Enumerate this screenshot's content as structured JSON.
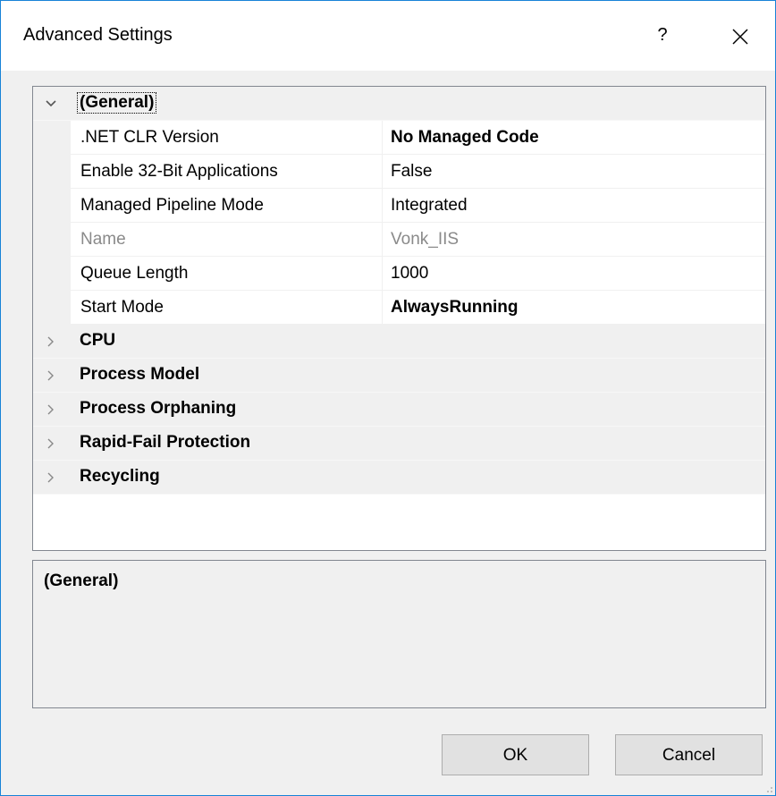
{
  "window": {
    "title": "Advanced Settings",
    "help_label": "?",
    "accent_color": "#1883d7"
  },
  "grid": {
    "general_category": {
      "label": "(General)",
      "expanded": true,
      "properties": [
        {
          "name": ".NET CLR Version",
          "value": "No Managed Code",
          "bold": true,
          "disabled": false
        },
        {
          "name": "Enable 32-Bit Applications",
          "value": "False",
          "bold": false,
          "disabled": false
        },
        {
          "name": "Managed Pipeline Mode",
          "value": "Integrated",
          "bold": false,
          "disabled": false
        },
        {
          "name": "Name",
          "value": "Vonk_IIS",
          "bold": false,
          "disabled": true
        },
        {
          "name": "Queue Length",
          "value": "1000",
          "bold": false,
          "disabled": false
        },
        {
          "name": "Start Mode",
          "value": "AlwaysRunning",
          "bold": true,
          "disabled": false
        }
      ]
    },
    "collapsed_categories": [
      {
        "label": "CPU"
      },
      {
        "label": "Process Model"
      },
      {
        "label": "Process Orphaning"
      },
      {
        "label": "Rapid-Fail Protection"
      },
      {
        "label": "Recycling"
      }
    ]
  },
  "description": {
    "title": "(General)"
  },
  "buttons": {
    "ok_label": "OK",
    "cancel_label": "Cancel"
  }
}
